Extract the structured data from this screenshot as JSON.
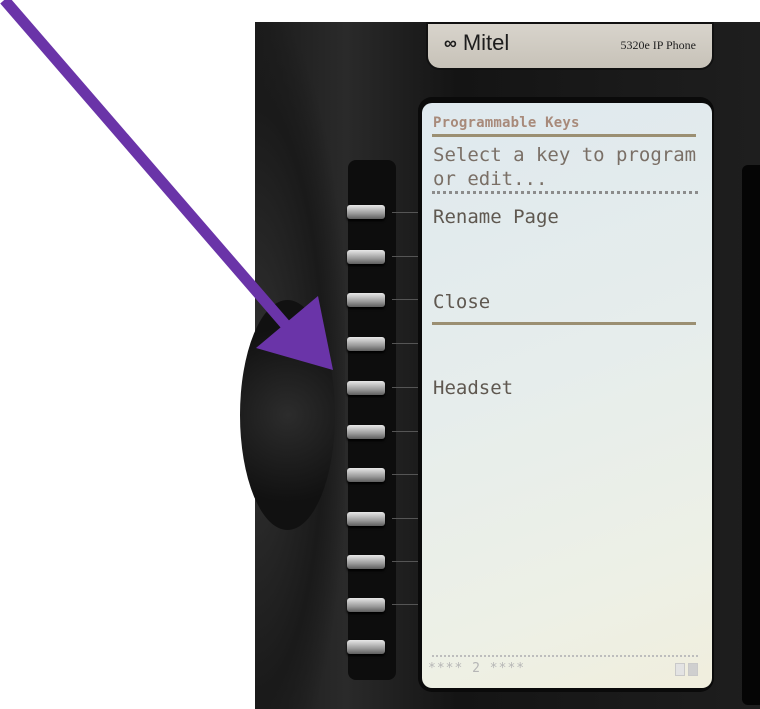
{
  "nameplate": {
    "brand": "Mitel",
    "logo_icon": "mitel-logo-icon",
    "model": "5320e IP Phone"
  },
  "screen": {
    "header": "Programmable Keys",
    "prompt_line1": "Select a key to program",
    "prompt_line2": "or edit...",
    "items": [
      "Rename Page",
      "Close",
      "Headset"
    ],
    "footer": "**** 2 ****"
  },
  "colors": {
    "arrow": "#6a34a8",
    "screen_text": "#6d625a",
    "header_text": "#a88a7a"
  },
  "icons": [
    "arrow-annotation-icon",
    "page-indicator-icon"
  ]
}
